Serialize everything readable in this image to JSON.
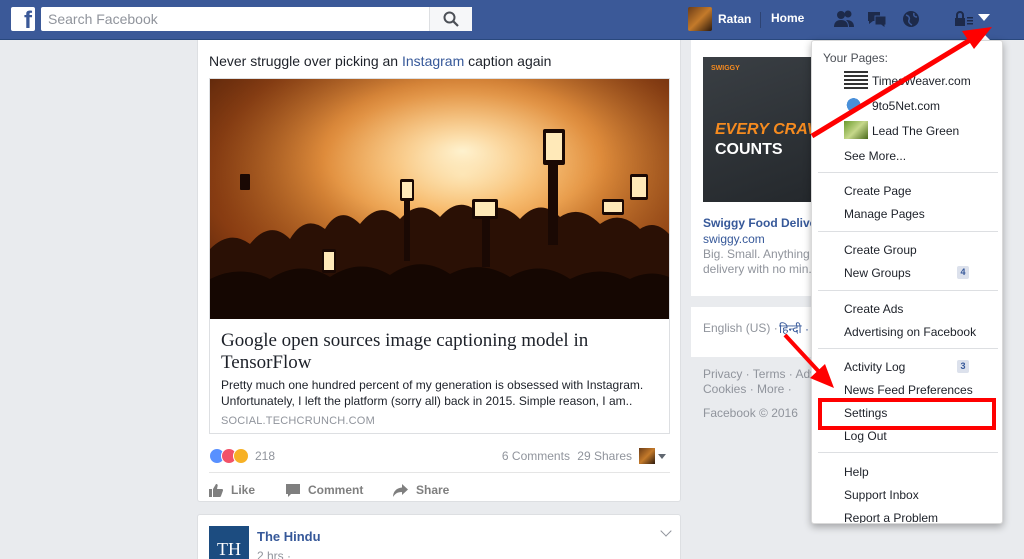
{
  "topbar": {
    "search_placeholder": "Search Facebook",
    "user_name": "Ratan",
    "home_label": "Home"
  },
  "post1": {
    "headline_pre": "Never struggle over picking an ",
    "headline_link": "Instagram",
    "headline_post": " caption again",
    "link_title": "Google open sources image captioning model in TensorFlow",
    "link_desc": "Pretty much one hundred percent of my generation is obsessed with Instagram. Unfortunately, I left the platform (sorry all) back in 2015. Simple reason, I am..",
    "link_source": "SOCIAL.TECHCRUNCH.COM",
    "reaction_count": "218",
    "comments": "6 Comments",
    "shares": "29 Shares",
    "actions": {
      "like": "Like",
      "comment": "Comment",
      "share": "Share"
    }
  },
  "post2": {
    "logo_text": "TH",
    "page_name": "The Hindu",
    "time": "2 hrs ·"
  },
  "ad": {
    "brand": "SWIGGY",
    "line1": "EVERY CRAV",
    "line2": "COUNTS",
    "title": "Swiggy Food Delive",
    "domain": "swiggy.com",
    "desc1": "Big. Small. Anything",
    "desc2": "delivery with no min."
  },
  "lang": {
    "english": "English (US) ·",
    "hindi": "हिन्दी ·"
  },
  "footer": {
    "row1": "Privacy · Terms · Adv",
    "row2": "Cookies · More ·",
    "copyright": "Facebook © 2016"
  },
  "dropdown": {
    "your_pages": "Your Pages:",
    "pages": [
      "TimesWeaver.com",
      "9to5Net.com",
      "Lead The Green"
    ],
    "see_more": "See More...",
    "create_page": "Create Page",
    "manage_pages": "Manage Pages",
    "create_group": "Create Group",
    "new_groups": "New Groups",
    "new_groups_badge": "4",
    "create_ads": "Create Ads",
    "advertising": "Advertising on Facebook",
    "activity_log": "Activity Log",
    "activity_badge": "3",
    "news_feed_prefs": "News Feed Preferences",
    "settings": "Settings",
    "log_out": "Log Out",
    "help": "Help",
    "support_inbox": "Support Inbox",
    "report_problem": "Report a Problem"
  },
  "colors": {
    "brand": "#3b5998",
    "link": "#365899",
    "annotation": "#ff0000"
  }
}
